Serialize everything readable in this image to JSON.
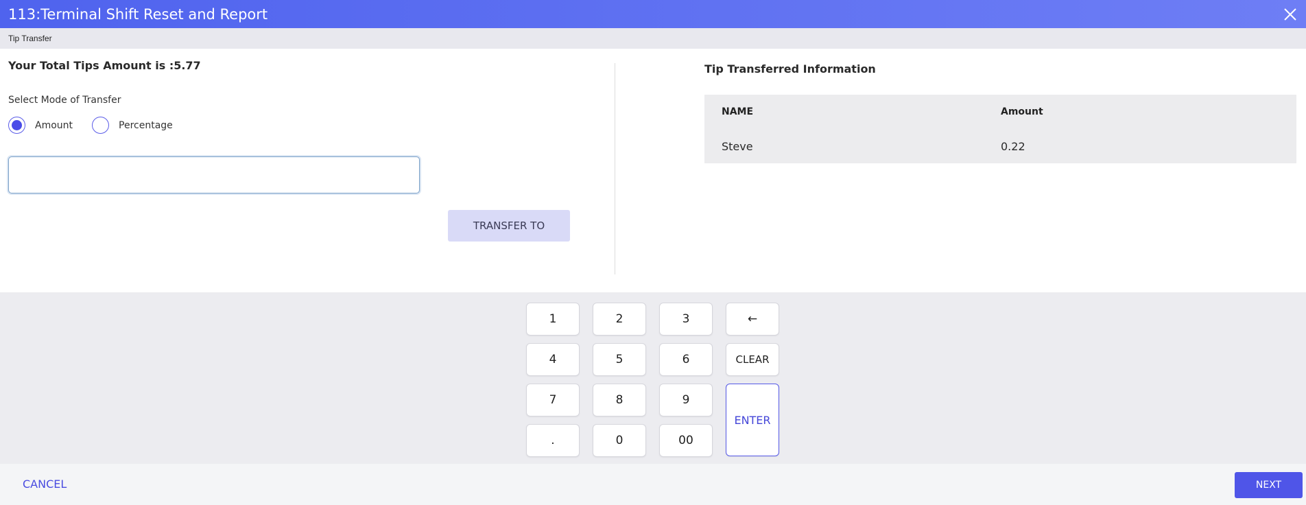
{
  "window": {
    "title": "113:Terminal Shift Reset and Report",
    "close_icon": "close-icon"
  },
  "subheader": {
    "label": "Tip Transfer"
  },
  "left": {
    "total_tips": "Your Total Tips Amount is :5.77",
    "mode_label": "Select Mode of Transfer",
    "modes": [
      {
        "label": "Amount",
        "selected": true
      },
      {
        "label": "Percentage",
        "selected": false
      }
    ],
    "amount_input": {
      "value": "",
      "placeholder": ""
    },
    "transfer_button": "TRANSFER TO"
  },
  "right": {
    "title": "Tip Transferred Information",
    "columns": [
      "NAME",
      "Amount"
    ],
    "rows": [
      {
        "name": "Steve",
        "amount": "0.22"
      }
    ]
  },
  "keypad": {
    "keys": [
      [
        "1",
        "2",
        "3",
        "←"
      ],
      [
        "4",
        "5",
        "6",
        "CLEAR"
      ],
      [
        "7",
        "8",
        "9",
        "ENTER"
      ],
      [
        ".",
        "0",
        "00"
      ]
    ]
  },
  "footer": {
    "cancel": "CANCEL",
    "next": "NEXT"
  },
  "colors": {
    "accent": "#4f55e8",
    "titlebar": "#5a6df0",
    "transfer_button_bg": "#d9daf7",
    "keypad_bg": "#ececf0"
  }
}
